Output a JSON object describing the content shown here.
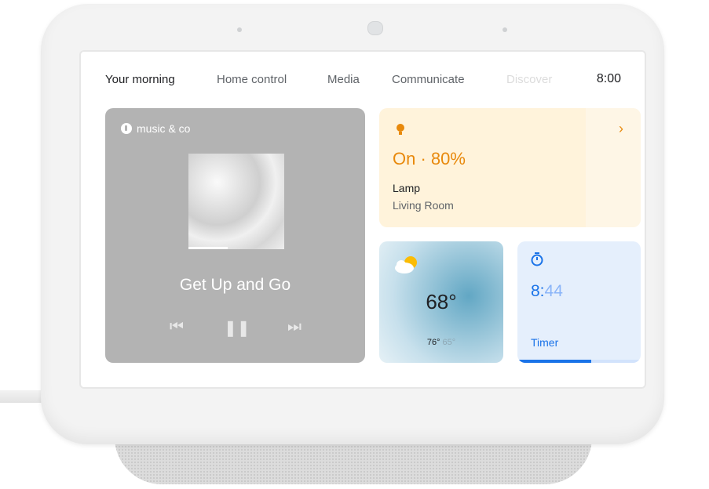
{
  "tabs": [
    {
      "label": "Your morning",
      "state": "active"
    },
    {
      "label": "Home control",
      "state": "normal"
    },
    {
      "label": "Media",
      "state": "normal"
    },
    {
      "label": "Communicate",
      "state": "normal"
    },
    {
      "label": "Discover",
      "state": "faded"
    }
  ],
  "clock": "8:00",
  "media": {
    "app_name": "music & co",
    "app_icon": "music-note-icon",
    "track_title": "Get Up and Go",
    "controls": {
      "prev_glyph": "⏮",
      "pause_glyph": "❚❚",
      "next_glyph": "⏭"
    }
  },
  "lamp": {
    "icon": "lightbulb-icon",
    "state": "On · 80%",
    "brightness_percent": 80,
    "name": "Lamp",
    "room": "Living Room",
    "chevron": "›"
  },
  "weather": {
    "icon": "partly-cloudy-icon",
    "current": "68°",
    "high": "76°",
    "low": "65°"
  },
  "timer": {
    "icon": "stopwatch-icon",
    "value_main": "8:",
    "value_rest": "44",
    "label": "Timer",
    "progress_fraction": 0.6
  },
  "colors": {
    "accent_blue": "#1a73e8",
    "lamp_orange": "#e8890c",
    "lamp_card_bg": "#fff3db",
    "media_card_bg": "#b3b3b3"
  }
}
